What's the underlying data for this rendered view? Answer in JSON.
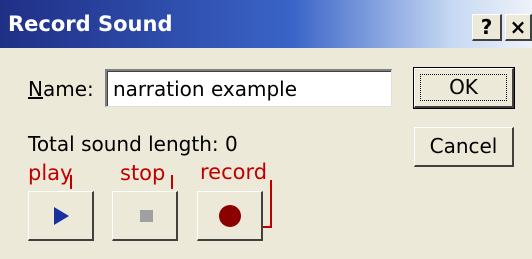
{
  "window": {
    "title": "Record Sound",
    "help_label": "?",
    "close_label": "×"
  },
  "form": {
    "name_label_underlined": "N",
    "name_label_rest": "ame:",
    "name_value": "narration example",
    "length_label": "Total sound length:  0"
  },
  "buttons": {
    "ok": "OK",
    "cancel": "Cancel"
  },
  "annotations": {
    "play": "play",
    "stop": "stop",
    "record": "record"
  },
  "colors": {
    "annotation": "#c00000",
    "play_glyph": "#1a2fa0",
    "record_glyph": "#8b0000"
  },
  "icons": [
    "help-icon",
    "close-icon",
    "play-icon",
    "stop-icon",
    "record-icon"
  ]
}
